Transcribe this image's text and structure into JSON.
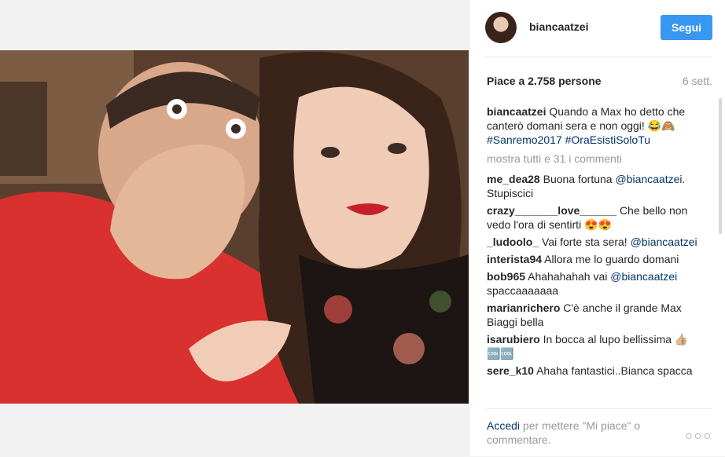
{
  "post": {
    "username": "biancaatzei",
    "follow_label": "Segui",
    "likes": "Piace a 2.758 persone",
    "time_ago": "6 sett."
  },
  "caption": {
    "username": "biancaatzei",
    "text": "Quando a Max ho detto che canterò domani sera e non oggi! 😂🙈",
    "hashtags": "#Sanremo2017 #OraEsistiSoloTu"
  },
  "load_more": "mostra tutti e 31 i commenti",
  "comments": [
    {
      "user": "me_dea28",
      "text": "Buona fortuna ",
      "mention": "@biancaatzei",
      "after": ". Stupiscici"
    },
    {
      "user": "crazy_______love______",
      "text": "Che bello non vedo l'ora di sentirti 😍😍",
      "mention": "",
      "after": ""
    },
    {
      "user": "_ludoolo_",
      "text": "Vai forte sta sera! ",
      "mention": "@biancaatzei",
      "after": ""
    },
    {
      "user": "interista94",
      "text": "Allora me lo guardo domani",
      "mention": "",
      "after": ""
    },
    {
      "user": "bob965",
      "text": "Ahahahahah vai ",
      "mention": "@biancaatzei",
      "after": " spaccaaaaaaa"
    },
    {
      "user": "marianrichero",
      "text": "C'è anche il grande Max Biaggi bella",
      "mention": "",
      "after": ""
    },
    {
      "user": "isarubiero",
      "text": "In bocca al lupo bellissima 👍🏼🆒🆒",
      "mention": "",
      "after": ""
    },
    {
      "user": "sere_k10",
      "text": "Ahaha fantastici..Bianca spacca",
      "mention": "",
      "after": ""
    }
  ],
  "footer": {
    "login_link": "Accedi",
    "text": " per mettere \"Mi piace\" o commentare.",
    "more_icon": "ellipsis-icon"
  }
}
